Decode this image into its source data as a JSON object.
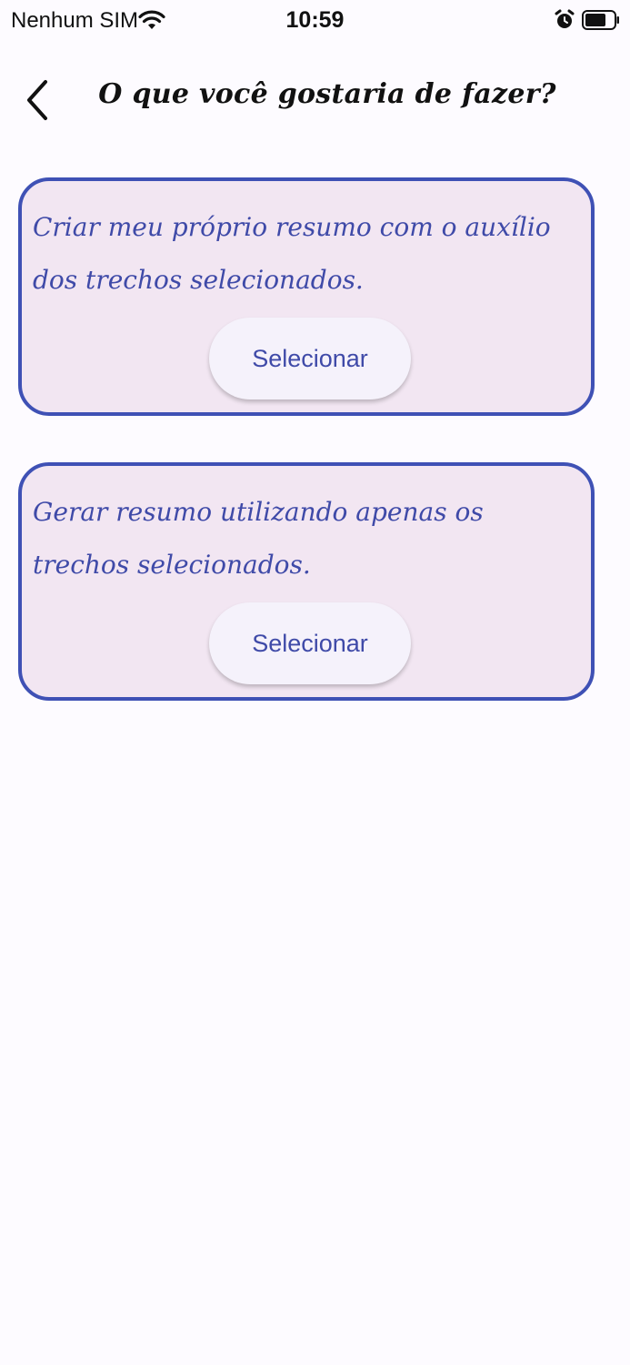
{
  "status_bar": {
    "carrier": "Nenhum SIM",
    "time": "10:59",
    "icons": [
      "wifi-icon",
      "alarm-icon",
      "battery-icon"
    ]
  },
  "header": {
    "back_icon": "chevron-left-icon",
    "title": "O que você gostaria de fazer?"
  },
  "options": [
    {
      "text": "Criar meu próprio resumo com o auxílio dos trechos selecionados.",
      "button_label": "Selecionar"
    },
    {
      "text": "Gerar resumo utilizando apenas os trechos selecionados.",
      "button_label": "Selecionar"
    }
  ],
  "colors": {
    "accent": "#3f51b5",
    "card_background": "#f2e6f2",
    "button_background": "#f5f2fb",
    "page_background": "#fdfbff"
  }
}
